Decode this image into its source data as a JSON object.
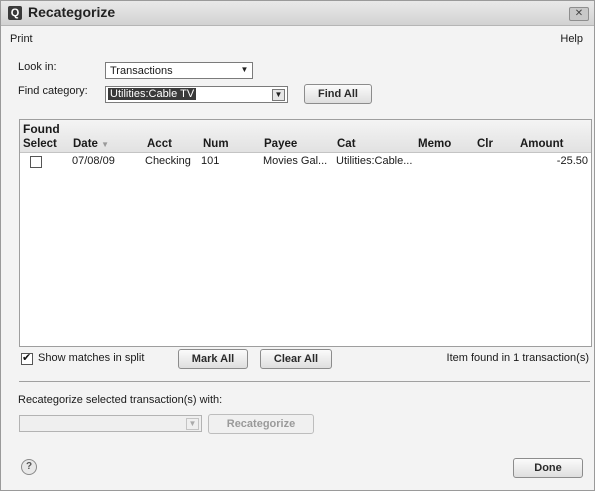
{
  "window": {
    "title": "Recategorize",
    "app_icon": "Q",
    "close_icon": "close-icon"
  },
  "menu": {
    "print": "Print",
    "help": "Help"
  },
  "look_in": {
    "label": "Look in:",
    "value": "Transactions"
  },
  "find_category": {
    "label": "Find category:",
    "value": "Utilities:Cable TV"
  },
  "find_all_button": "Find All",
  "found": {
    "title": "Found",
    "columns": [
      "Select",
      "Date",
      "Acct",
      "Num",
      "Payee",
      "Cat",
      "Memo",
      "Clr",
      "Amount"
    ],
    "rows": [
      {
        "select": false,
        "date": "07/08/09",
        "acct": "Checking",
        "num": "101",
        "payee": "Movies Gal...",
        "cat": "Utilities:Cable...",
        "memo": "",
        "clr": "",
        "amount": "-25.50"
      }
    ]
  },
  "show_matches": {
    "label": "Show matches in split",
    "checked": true
  },
  "mark_all_button": "Mark All",
  "clear_all_button": "Clear All",
  "status_text": "Item found in 1 transaction(s)",
  "recategorize": {
    "label": "Recategorize selected transaction(s) with:",
    "value": "",
    "button": "Recategorize"
  },
  "done_button": "Done",
  "help_icon_glyph": "?"
}
